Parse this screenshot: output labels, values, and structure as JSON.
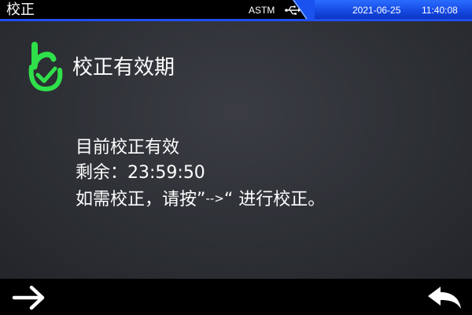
{
  "header": {
    "title": "校正",
    "standard": "ASTM",
    "usb_icon": "usb-icon",
    "date": "2021-06-25",
    "time": "11:40:08",
    "accent_color": "#1a52ef"
  },
  "main": {
    "status_icon": "ok-hand-check-icon",
    "status_icon_color": "#2fe04a",
    "heading": "校正有效期",
    "lines": {
      "status": "目前校正有效",
      "remaining": "剩余：23:59:50",
      "instruction_prefix": "如需校正，请按”",
      "instruction_arrow": "-->",
      "instruction_suffix": "“ 进行校正。"
    }
  },
  "footer": {
    "next_icon": "arrow-right-icon",
    "back_icon": "return-arrow-icon"
  }
}
